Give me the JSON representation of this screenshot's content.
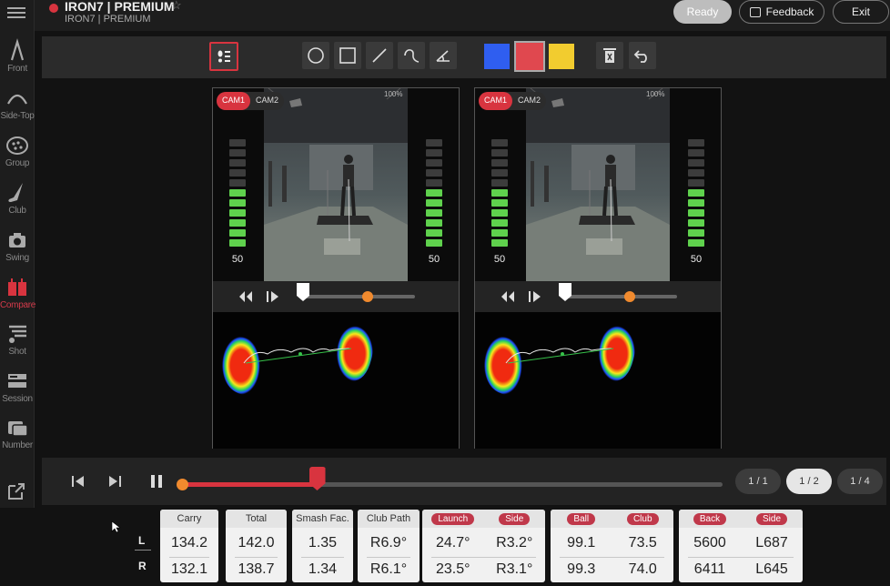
{
  "header": {
    "title": "IRON7 | PREMIUM",
    "subtitle": "IRON7 | PREMIUM",
    "ready_label": "Ready",
    "feedback_label": "Feedback",
    "exit_label": "Exit"
  },
  "sidebar": {
    "items": [
      {
        "label": "Front",
        "icon": "front-swing-icon"
      },
      {
        "label": "Side-Top",
        "icon": "side-top-icon"
      },
      {
        "label": "Group",
        "icon": "group-icon"
      },
      {
        "label": "Club",
        "icon": "club-icon"
      },
      {
        "label": "Swing",
        "icon": "camera-icon"
      },
      {
        "label": "Compare",
        "icon": "compare-icon",
        "active": true
      },
      {
        "label": "Shot",
        "icon": "shot-icon"
      },
      {
        "label": "Session",
        "icon": "session-icon"
      },
      {
        "label": "Number",
        "icon": "number-icon"
      }
    ]
  },
  "toolbar": {
    "colors": [
      "#2f5ef0",
      "#e0484f",
      "#f2cc2f"
    ],
    "selected_color": "#e0484f"
  },
  "panels": [
    {
      "cam_tabs": [
        "CAM1",
        "CAM2"
      ],
      "active_cam": "CAM1",
      "zoom": "100%",
      "left_meter": "50",
      "right_meter": "50",
      "meter_level": 6
    },
    {
      "cam_tabs": [
        "CAM1",
        "CAM2"
      ],
      "active_cam": "CAM1",
      "zoom": "100%",
      "left_meter": "50",
      "right_meter": "50",
      "meter_level": 6
    }
  ],
  "playback": {
    "pages": [
      "1 / 1",
      "1 / 2",
      "1 / 4"
    ],
    "selected_page": "1 / 2",
    "progress": 0.25
  },
  "stats": {
    "row_labels": [
      "L",
      "R"
    ],
    "groups": [
      {
        "headers": [
          "Carry"
        ],
        "values": [
          [
            "134.2",
            "132.1"
          ]
        ]
      },
      {
        "headers": [
          "Total"
        ],
        "values": [
          [
            "142.0",
            "138.7"
          ]
        ]
      },
      {
        "headers": [
          "Smash Fac."
        ],
        "values": [
          [
            "1.35",
            "1.34"
          ]
        ]
      },
      {
        "headers": [
          "Club Path"
        ],
        "values": [
          [
            "R6.9°",
            "R6.1°"
          ]
        ]
      },
      {
        "headers": [
          "Launch",
          "Side"
        ],
        "tagged": true,
        "values": [
          [
            "24.7°",
            "23.5°"
          ],
          [
            "R3.2°",
            "R3.1°"
          ]
        ]
      },
      {
        "headers": [
          "Ball",
          "Club"
        ],
        "tagged": true,
        "values": [
          [
            "99.1",
            "99.3"
          ],
          [
            "73.5",
            "74.0"
          ]
        ]
      },
      {
        "headers": [
          "Back",
          "Side"
        ],
        "tagged": true,
        "values": [
          [
            "5600",
            "6411"
          ],
          [
            "L687",
            "L645"
          ]
        ]
      }
    ]
  }
}
